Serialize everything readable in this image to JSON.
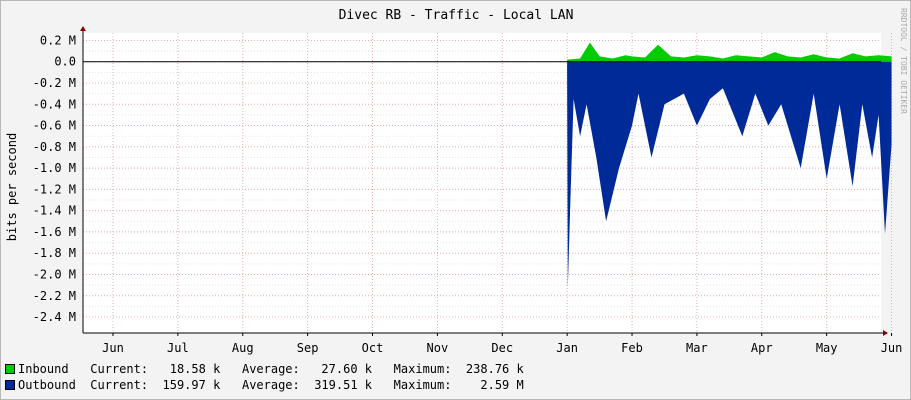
{
  "chart_data": {
    "type": "area",
    "title": "Divec RB - Traffic - Local LAN",
    "ylabel": "bits per second",
    "watermark": "RRDTOOL / TOBI OETIKER",
    "x_categories": [
      "Jun",
      "Jul",
      "Aug",
      "Sep",
      "Oct",
      "Nov",
      "Dec",
      "Jan",
      "Feb",
      "Mar",
      "Apr",
      "May",
      "Jun"
    ],
    "y_ticks": [
      "0.2 M",
      "0.0",
      "-0.2 M",
      "-0.4 M",
      "-0.6 M",
      "-0.8 M",
      "-1.0 M",
      "-1.2 M",
      "-1.4 M",
      "-1.6 M",
      "-1.8 M",
      "-2.0 M",
      "-2.2 M",
      "-2.4 M"
    ],
    "ylim": [
      -2.55,
      0.27
    ],
    "grid": true,
    "colors": {
      "inbound": "#00cc00",
      "outbound": "#002a97",
      "grid": "#e0b0b0",
      "axis": "#000000",
      "arrow": "#8b0000"
    },
    "series": [
      {
        "name": "Inbound",
        "color": "#00cc00",
        "x": [
          7.0,
          7.2,
          7.35,
          7.5,
          7.7,
          7.9,
          8.0,
          8.2,
          8.4,
          8.6,
          8.8,
          9.0,
          9.2,
          9.4,
          9.6,
          9.8,
          10.0,
          10.2,
          10.4,
          10.6,
          10.8,
          11.0,
          11.2,
          11.4,
          11.6,
          11.8,
          12.0
        ],
        "values": [
          0.02,
          0.03,
          0.18,
          0.05,
          0.03,
          0.06,
          0.05,
          0.04,
          0.16,
          0.05,
          0.04,
          0.06,
          0.05,
          0.03,
          0.06,
          0.05,
          0.04,
          0.09,
          0.05,
          0.04,
          0.07,
          0.04,
          0.03,
          0.08,
          0.05,
          0.06,
          0.05
        ]
      },
      {
        "name": "Outbound",
        "color": "#002a97",
        "x": [
          7.0,
          7.01,
          7.05,
          7.1,
          7.2,
          7.3,
          7.45,
          7.6,
          7.8,
          8.0,
          8.1,
          8.3,
          8.5,
          8.8,
          9.0,
          9.2,
          9.4,
          9.7,
          9.9,
          10.1,
          10.3,
          10.6,
          10.8,
          11.0,
          11.2,
          11.4,
          11.55,
          11.7,
          11.8,
          11.9,
          12.0
        ],
        "values": [
          -0.05,
          -2.13,
          -1.3,
          -0.35,
          -0.7,
          -0.4,
          -0.9,
          -1.5,
          -1.0,
          -0.6,
          -0.3,
          -0.9,
          -0.4,
          -0.3,
          -0.6,
          -0.35,
          -0.25,
          -0.7,
          -0.3,
          -0.6,
          -0.4,
          -1.0,
          -0.3,
          -1.1,
          -0.4,
          -1.17,
          -0.4,
          -0.9,
          -0.5,
          -1.62,
          -0.78
        ]
      }
    ]
  },
  "legend": [
    {
      "name": "Inbound",
      "text": "Inbound   Current:   18.58 k   Average:   27.60 k   Maximum:  238.76 k"
    },
    {
      "name": "Outbound",
      "text": "Outbound  Current:  159.97 k   Average:  319.51 k   Maximum:    2.59 M"
    }
  ]
}
